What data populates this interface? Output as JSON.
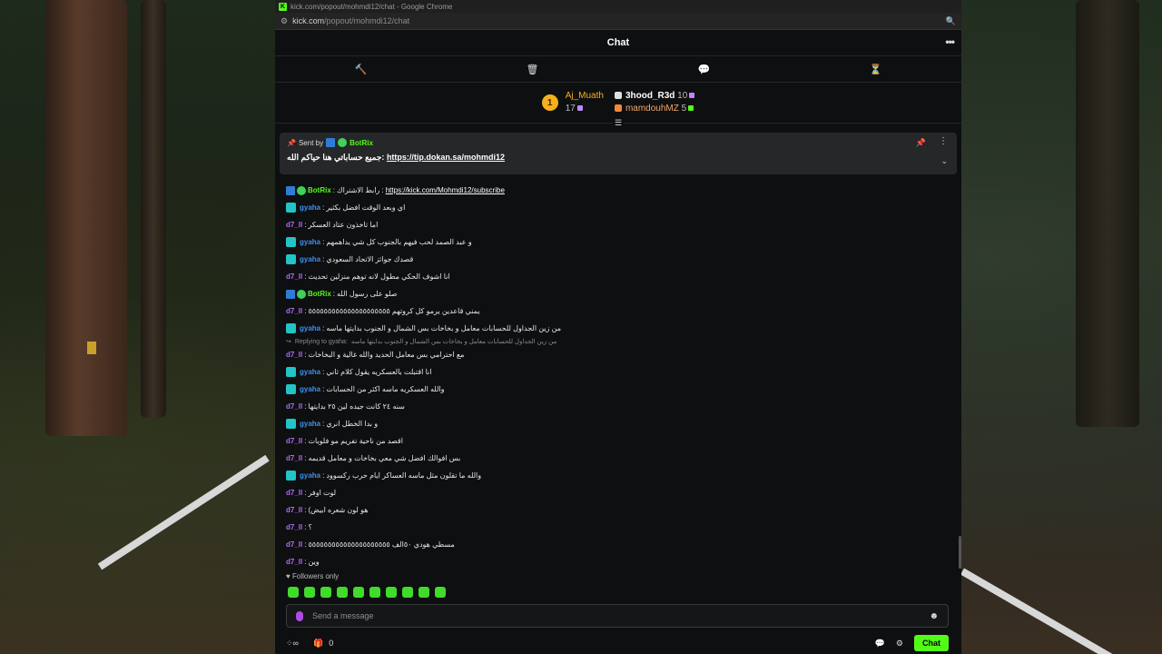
{
  "browser": {
    "title": "kick.com/popout/mohmdi12/chat - Google Chrome",
    "url_host": "kick.com",
    "url_path": "/popout/mohmdi12/chat"
  },
  "chat": {
    "header_title": "Chat",
    "leaderboard": [
      {
        "rank": "1",
        "name": "Aj_Muath",
        "count": "17"
      },
      {
        "name": "3hood_R3d",
        "count": "10"
      },
      {
        "name": "mamdouhMZ",
        "count": "5"
      }
    ],
    "pinned": {
      "sent_by_label": "Sent by",
      "user": "BotRix",
      "text": "جميع حساباتي هنا حياكم الله:",
      "link": "https://tip.dokan.sa/mohmdi12"
    },
    "messages": [
      {
        "user": "BotRix",
        "type": "bot",
        "text": "رابط الاشتراك :",
        "link": "https://kick.com/Mohmdi12/subscribe"
      },
      {
        "user": "gyaha",
        "type": "gy",
        "text": "اي وبعد الوقت افضل بكثير"
      },
      {
        "user": "d7_ll",
        "type": "d7",
        "text": "اما تاخذون عتاد العسكر"
      },
      {
        "user": "gyaha",
        "type": "gy",
        "text": "و عبد الصمد لحب فيهم بالجنوب كل شي يداهمهم"
      },
      {
        "user": "gyaha",
        "type": "gy",
        "text": "قصدك جوائز الاتحاد السعودي"
      },
      {
        "user": "d7_ll",
        "type": "d7",
        "text": "انا اشوف الحكي مطول لانه توهم منزلين تحديث"
      },
      {
        "user": "BotRix",
        "type": "bot",
        "text": "صلو على رسول الله"
      },
      {
        "user": "d7_ll",
        "type": "d7",
        "text": "يمني قاعدين يرمو كل كروتهم ٥٥٥٥٥٥٥٥٥٥٥٥٥٥٥٥٥٥٥٥٥"
      },
      {
        "user": "gyaha",
        "type": "gy",
        "text": "من زين الجداول للحسابات معامل و بخاخات بس الشمال و الجنوب بدايتها ماسه"
      },
      {
        "user": "d7_ll",
        "type": "d7",
        "reply": "Replying to gyaha:",
        "reply_text": "من زين الجداول للحسابات معامل و بخاخات بس الشمال و الجنوب بدايتها ماسه",
        "text": "مع احترامي بس معامل الحديد والله غالية و البخاخات"
      },
      {
        "user": "gyaha",
        "type": "gy",
        "text": "انا اقتبلت بالعسكريه يقول كلام ثاني"
      },
      {
        "user": "gyaha",
        "type": "gy",
        "text": "والله العسكريه ماسه اكثر من الحسابات"
      },
      {
        "user": "d7_ll",
        "type": "d7",
        "text": "سنه ٢٤ كانت جيده لين ٢٥ بدايتها"
      },
      {
        "user": "gyaha",
        "type": "gy",
        "text": "و بدا الخطل انري"
      },
      {
        "user": "d7_ll",
        "type": "d7",
        "text": "اقصد من ناحية تفريم مو فلوبات"
      },
      {
        "user": "d7_ll",
        "type": "d7",
        "text": "بس افوالك افضل شي معي بخاخات و معامل قديمه"
      },
      {
        "user": "gyaha",
        "type": "gy",
        "text": "والله ما تقلون مثل ماسه العساكر ايام حرب ركسوود"
      },
      {
        "user": "d7_ll",
        "type": "d7",
        "text": "لوت اوفر"
      },
      {
        "user": "d7_ll",
        "type": "d7",
        "text": "(هو لون شعره ابيض"
      },
      {
        "user": "d7_ll",
        "type": "d7",
        "text": "؟"
      },
      {
        "user": "d7_ll",
        "type": "d7",
        "text": "مسطي هودي ٥٠الف ٥٥٥٥٥٥٥٥٥٥٥٥٥٥٥٥٥٥٥٥٥"
      },
      {
        "user": "d7_ll",
        "type": "d7",
        "text": "وين"
      }
    ],
    "followers_only": "Followers only",
    "input_placeholder": "Send a message",
    "footer": {
      "count_label": "0",
      "chat_button": "Chat"
    }
  }
}
